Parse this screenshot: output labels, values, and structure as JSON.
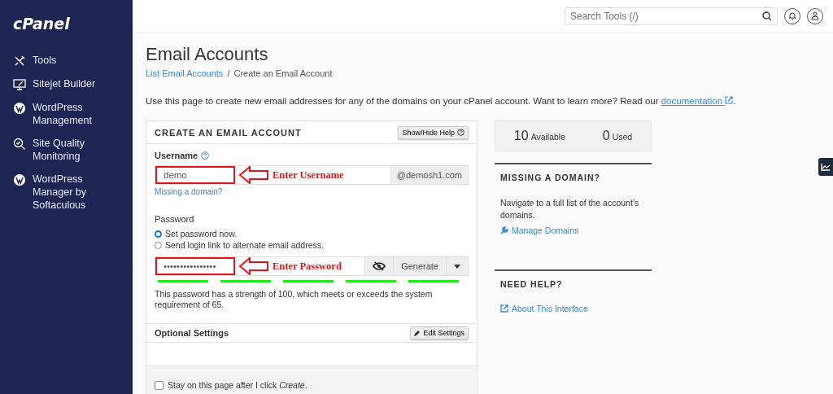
{
  "sidebar": {
    "logo": "cPanel",
    "items": [
      {
        "kind": "tools",
        "label": "Tools"
      },
      {
        "kind": "sitejet",
        "label": "Sitejet Builder"
      },
      {
        "kind": "wordpress",
        "label": "WordPress Management"
      },
      {
        "kind": "quality",
        "label": "Site Quality Monitoring"
      },
      {
        "kind": "wordpress",
        "label": "WordPress Manager by Softaculous"
      }
    ]
  },
  "topbar": {
    "search": {
      "placeholder": "Search Tools (/)"
    }
  },
  "page": {
    "title": "Email Accounts",
    "breadcrumb": [
      {
        "label": "List Email Accounts",
        "link": true
      },
      {
        "label": "Create an Email Account",
        "link": false
      }
    ],
    "breadcrumb_separator": "/",
    "description": "Use this page to create new email addresses for any of the domains on your cPanel account. Want to learn more? Read our",
    "description_link": "documentation",
    "description_end": "."
  },
  "form": {
    "title": "CREATE AN EMAIL ACCOUNT",
    "help_button": "Show/Hide Help",
    "username": {
      "label": "Username",
      "value": "demo",
      "domain": "@demosh1.com",
      "annotation": "Enter Username",
      "missing_link": "Missing a domain?"
    },
    "password": {
      "label": "Password",
      "options": [
        {
          "label": "Set password now.",
          "selected": true
        },
        {
          "label": "Send login link to alternate email address.",
          "selected": false
        }
      ],
      "value": "••••••••••••••••",
      "annotation": "Enter Password",
      "generate": "Generate",
      "strength": {
        "level": 1
      },
      "strength_text": "This password has a strength of 100, which meets or exceeds the system requirement of 65."
    },
    "optional": {
      "title": "Optional Settings",
      "button": "Edit Settings"
    },
    "stay": {
      "label": "Stay on this page after I click ",
      "emph": "Create",
      "end": ".",
      "checked": false
    }
  },
  "stats": [
    {
      "value": "10",
      "label": "Available"
    },
    {
      "value": "0",
      "label": "Used"
    }
  ],
  "missing_domain": {
    "title": "MISSING A DOMAIN?",
    "text": "Navigate to a full list of the account’s domains.",
    "link": "Manage Domains"
  },
  "need_help": {
    "title": "NEED HELP?",
    "link": "About This Interface"
  }
}
